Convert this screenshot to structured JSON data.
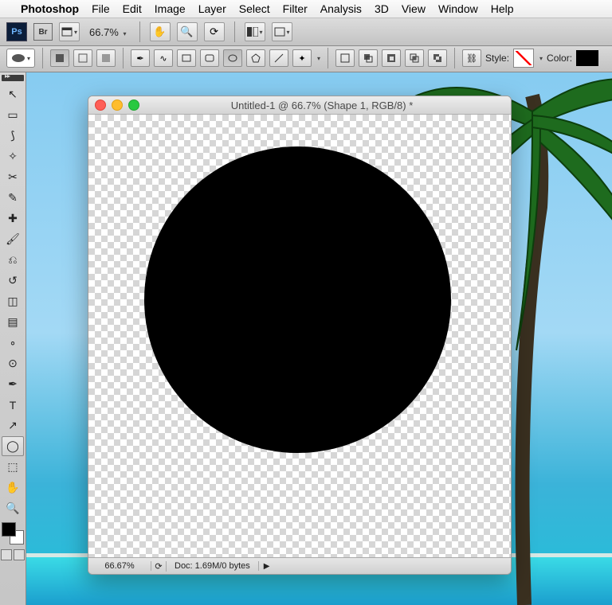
{
  "menubar": {
    "app": "Photoshop",
    "items": [
      "File",
      "Edit",
      "Image",
      "Layer",
      "Select",
      "Filter",
      "Analysis",
      "3D",
      "View",
      "Window",
      "Help"
    ]
  },
  "toolbar": {
    "ps_badge": "Ps",
    "br_badge": "Br",
    "zoom": "66.7%"
  },
  "options": {
    "style_label": "Style:",
    "color_label": "Color:",
    "fill_color": "#000000"
  },
  "tools": [
    {
      "name": "move-tool",
      "glyph": "↖"
    },
    {
      "name": "marquee-tool",
      "glyph": "▭"
    },
    {
      "name": "lasso-tool",
      "glyph": "⟆"
    },
    {
      "name": "magic-wand-tool",
      "glyph": "✧"
    },
    {
      "name": "crop-tool",
      "glyph": "✂"
    },
    {
      "name": "eyedropper-tool",
      "glyph": "✎"
    },
    {
      "name": "healing-brush-tool",
      "glyph": "✚"
    },
    {
      "name": "brush-tool",
      "glyph": "🖌"
    },
    {
      "name": "clone-stamp-tool",
      "glyph": "⎌"
    },
    {
      "name": "history-brush-tool",
      "glyph": "↺"
    },
    {
      "name": "eraser-tool",
      "glyph": "◫"
    },
    {
      "name": "gradient-tool",
      "glyph": "▤"
    },
    {
      "name": "blur-tool",
      "glyph": "∘"
    },
    {
      "name": "dodge-tool",
      "glyph": "⊙"
    },
    {
      "name": "pen-tool",
      "glyph": "✒"
    },
    {
      "name": "type-tool",
      "glyph": "T"
    },
    {
      "name": "path-select-tool",
      "glyph": "↗"
    },
    {
      "name": "ellipse-shape-tool",
      "glyph": "◯",
      "selected": true
    },
    {
      "name": "3d-tool",
      "glyph": "⬚"
    },
    {
      "name": "hand-tool",
      "glyph": "✋"
    },
    {
      "name": "zoom-tool",
      "glyph": "🔍"
    }
  ],
  "document": {
    "title": "Untitled-1 @ 66.7% (Shape 1, RGB/8) *",
    "status_zoom": "66.67%",
    "status_doc": "Doc: 1.69M/0 bytes"
  }
}
